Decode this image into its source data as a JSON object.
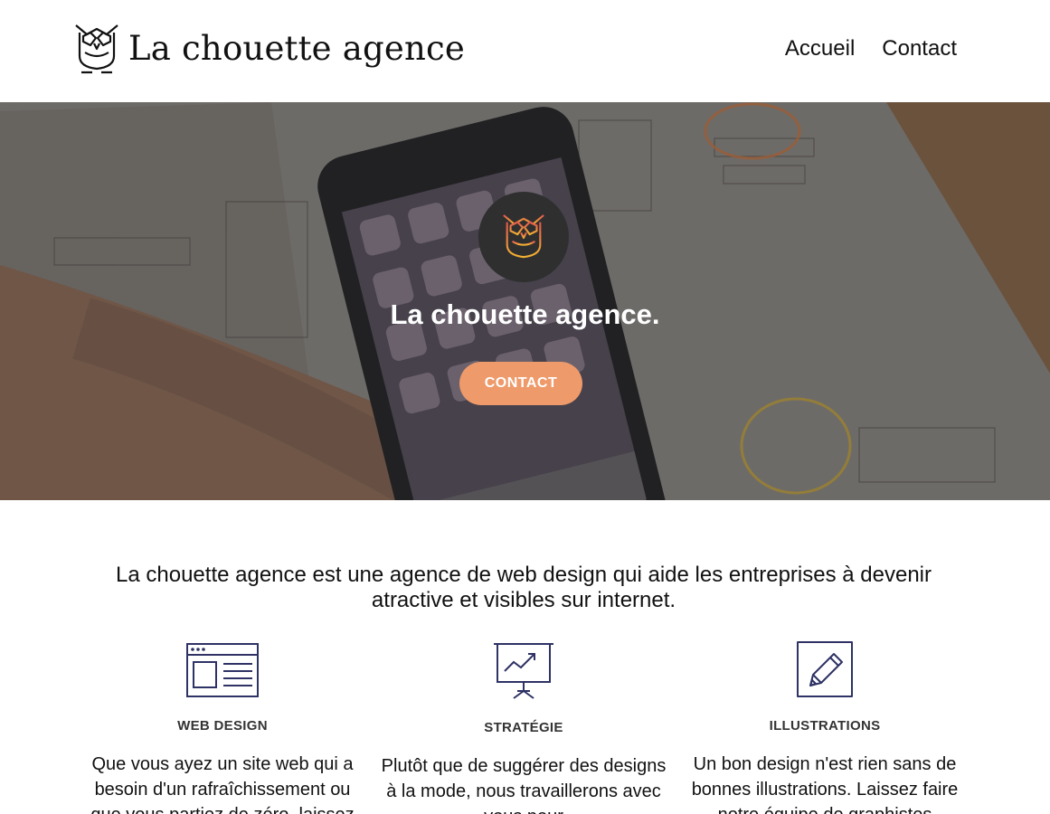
{
  "header": {
    "logo_text": "La chouette agence",
    "nav": [
      {
        "label": "Accueil"
      },
      {
        "label": "Contact"
      }
    ]
  },
  "hero": {
    "title": "La chouette agence.",
    "button_label": "CONTACT"
  },
  "intro": {
    "text": "La chouette agence est une agence de web design qui aide les entreprises à devenir atractive et visibles sur internet."
  },
  "services": [
    {
      "icon": "browser-window-icon",
      "title": "WEB DESIGN",
      "text": "Que vous ayez un site web qui a besoin d'un rafraîchissement ou que vous partiez de zéro, laissez"
    },
    {
      "icon": "presentation-chart-icon",
      "title": "STRATÉGIE",
      "text": "Plutôt que de suggérer des designs à la mode, nous travaillerons avec vous pour"
    },
    {
      "icon": "pencil-edit-icon",
      "title": "ILLUSTRATIONS",
      "text": "Un bon design n'est rien sans de bonnes illustrations. Laissez faire notre équipe de graphistes"
    }
  ],
  "colors": {
    "accent": "#ef9a6a",
    "icon_stroke": "#2e3264",
    "badge_bg": "#2f2f2f"
  }
}
